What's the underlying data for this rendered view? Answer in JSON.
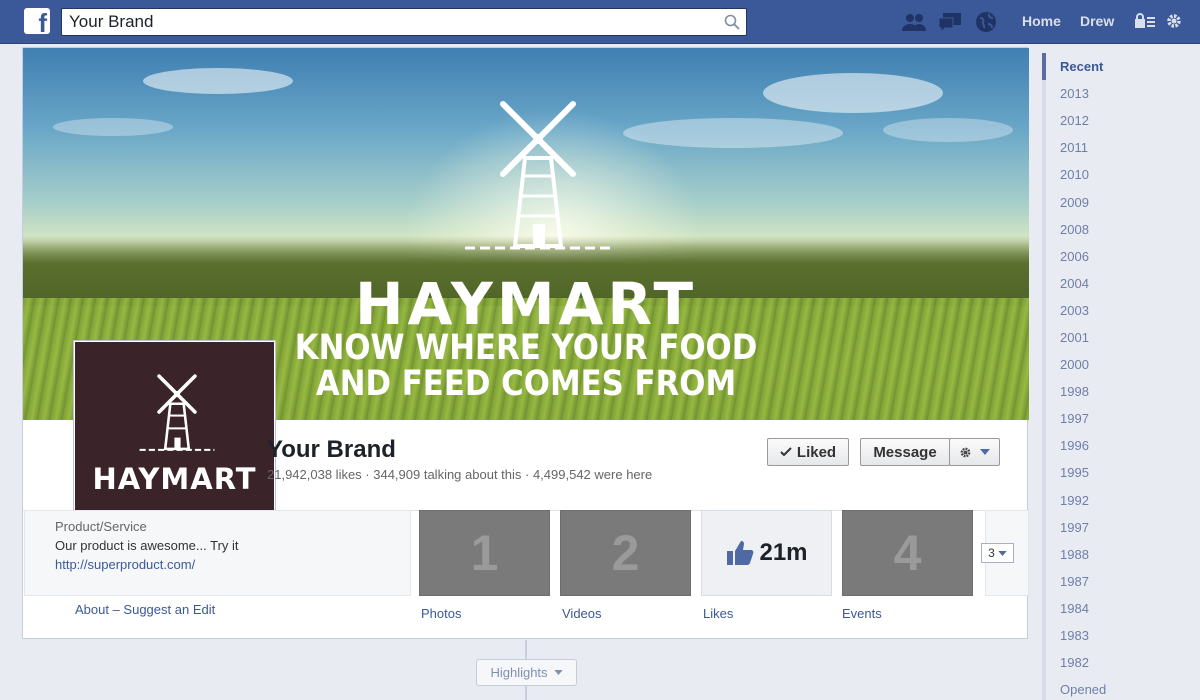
{
  "topbar": {
    "search_value": "Your Brand",
    "nav_home": "Home",
    "nav_user": "Drew",
    "icons": [
      "friends-icon",
      "messages-icon",
      "notifications-globe-icon",
      "privacy-icon",
      "gear-icon"
    ]
  },
  "cover": {
    "brand": "HAYMART",
    "tagline_line1": "KNOW WHERE YOUR FOOD",
    "tagline_line2": "AND FEED COMES FROM"
  },
  "profile": {
    "brand": "HAYMART"
  },
  "page": {
    "name": "Your Brand",
    "stats": "21,942,038 likes · 344,909 talking about this · 4,499,542 were here"
  },
  "actions": {
    "liked": "Liked",
    "message": "Message"
  },
  "about": {
    "category": "Product/Service",
    "description": "Our product is awesome... Try it",
    "url": "http://superproduct.com/",
    "link": "About – Suggest an Edit"
  },
  "apps": [
    {
      "tile": "1",
      "label": "Photos"
    },
    {
      "tile": "2",
      "label": "Videos"
    },
    {
      "tile": "21m",
      "label": "Likes"
    },
    {
      "tile": "4",
      "label": "Events"
    }
  ],
  "apps_more_count": "3",
  "highlights": "Highlights",
  "timeline_years": [
    "Recent",
    "2013",
    "2012",
    "2011",
    "2010",
    "2009",
    "2008",
    "2006",
    "2004",
    "2003",
    "2001",
    "2000",
    "1998",
    "1997",
    "1996",
    "1995",
    "1992",
    "1997",
    "1988",
    "1987",
    "1984",
    "1983",
    "1982",
    "Opened"
  ],
  "colors": {
    "brand_blue": "#3b5998",
    "profile_bg": "#3a2429"
  }
}
